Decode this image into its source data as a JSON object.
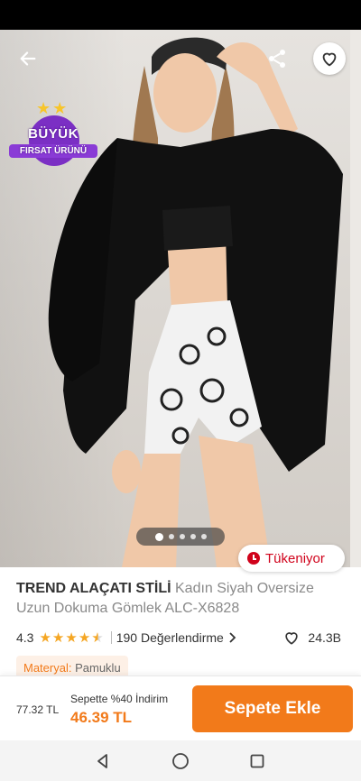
{
  "colors": {
    "accent": "#f27a1a",
    "stock_red": "#d0021b",
    "badge_purple": "#7b2fc4",
    "star": "#f5a623"
  },
  "header": {
    "back_icon": "arrow-left-icon",
    "share_icon": "share-icon",
    "favorite_icon": "heart-outline-icon"
  },
  "badge": {
    "line1": "BÜYÜK",
    "line2": "FIRSAT ÜRÜNÜ"
  },
  "gallery": {
    "dot_count": 5,
    "active_index": 0
  },
  "stock_status": "Tükeniyor",
  "product": {
    "brand": "TREND ALAÇATI STİLİ",
    "name": "Kadın Siyah Oversize Uzun Dokuma Gömlek ALC-X6828"
  },
  "rating": {
    "score": "4.3",
    "stars_value": 4.3,
    "reviews": "190 Değerlendirme",
    "favorites": "24.3B"
  },
  "material": {
    "label": "Materyal:",
    "value": "Pamuklu"
  },
  "purchase": {
    "old_price": "77.32 TL",
    "promo": "Sepette %40 İndirim",
    "new_price": "46.39 TL",
    "button": "Sepete Ekle"
  },
  "navigation": {
    "back": "back-triangle-icon",
    "home": "home-circle-icon",
    "recents": "recents-square-icon"
  }
}
